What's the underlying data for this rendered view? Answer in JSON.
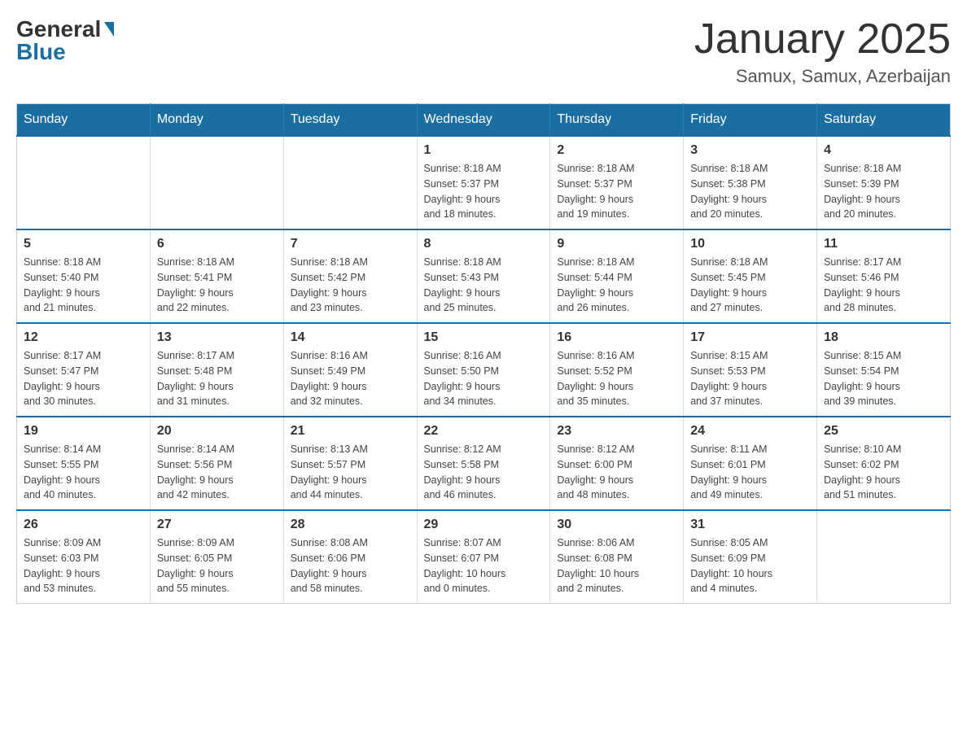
{
  "logo": {
    "general": "General",
    "blue": "Blue"
  },
  "title": "January 2025",
  "location": "Samux, Samux, Azerbaijan",
  "days_of_week": [
    "Sunday",
    "Monday",
    "Tuesday",
    "Wednesday",
    "Thursday",
    "Friday",
    "Saturday"
  ],
  "weeks": [
    [
      {
        "day": "",
        "info": ""
      },
      {
        "day": "",
        "info": ""
      },
      {
        "day": "",
        "info": ""
      },
      {
        "day": "1",
        "info": "Sunrise: 8:18 AM\nSunset: 5:37 PM\nDaylight: 9 hours\nand 18 minutes."
      },
      {
        "day": "2",
        "info": "Sunrise: 8:18 AM\nSunset: 5:37 PM\nDaylight: 9 hours\nand 19 minutes."
      },
      {
        "day": "3",
        "info": "Sunrise: 8:18 AM\nSunset: 5:38 PM\nDaylight: 9 hours\nand 20 minutes."
      },
      {
        "day": "4",
        "info": "Sunrise: 8:18 AM\nSunset: 5:39 PM\nDaylight: 9 hours\nand 20 minutes."
      }
    ],
    [
      {
        "day": "5",
        "info": "Sunrise: 8:18 AM\nSunset: 5:40 PM\nDaylight: 9 hours\nand 21 minutes."
      },
      {
        "day": "6",
        "info": "Sunrise: 8:18 AM\nSunset: 5:41 PM\nDaylight: 9 hours\nand 22 minutes."
      },
      {
        "day": "7",
        "info": "Sunrise: 8:18 AM\nSunset: 5:42 PM\nDaylight: 9 hours\nand 23 minutes."
      },
      {
        "day": "8",
        "info": "Sunrise: 8:18 AM\nSunset: 5:43 PM\nDaylight: 9 hours\nand 25 minutes."
      },
      {
        "day": "9",
        "info": "Sunrise: 8:18 AM\nSunset: 5:44 PM\nDaylight: 9 hours\nand 26 minutes."
      },
      {
        "day": "10",
        "info": "Sunrise: 8:18 AM\nSunset: 5:45 PM\nDaylight: 9 hours\nand 27 minutes."
      },
      {
        "day": "11",
        "info": "Sunrise: 8:17 AM\nSunset: 5:46 PM\nDaylight: 9 hours\nand 28 minutes."
      }
    ],
    [
      {
        "day": "12",
        "info": "Sunrise: 8:17 AM\nSunset: 5:47 PM\nDaylight: 9 hours\nand 30 minutes."
      },
      {
        "day": "13",
        "info": "Sunrise: 8:17 AM\nSunset: 5:48 PM\nDaylight: 9 hours\nand 31 minutes."
      },
      {
        "day": "14",
        "info": "Sunrise: 8:16 AM\nSunset: 5:49 PM\nDaylight: 9 hours\nand 32 minutes."
      },
      {
        "day": "15",
        "info": "Sunrise: 8:16 AM\nSunset: 5:50 PM\nDaylight: 9 hours\nand 34 minutes."
      },
      {
        "day": "16",
        "info": "Sunrise: 8:16 AM\nSunset: 5:52 PM\nDaylight: 9 hours\nand 35 minutes."
      },
      {
        "day": "17",
        "info": "Sunrise: 8:15 AM\nSunset: 5:53 PM\nDaylight: 9 hours\nand 37 minutes."
      },
      {
        "day": "18",
        "info": "Sunrise: 8:15 AM\nSunset: 5:54 PM\nDaylight: 9 hours\nand 39 minutes."
      }
    ],
    [
      {
        "day": "19",
        "info": "Sunrise: 8:14 AM\nSunset: 5:55 PM\nDaylight: 9 hours\nand 40 minutes."
      },
      {
        "day": "20",
        "info": "Sunrise: 8:14 AM\nSunset: 5:56 PM\nDaylight: 9 hours\nand 42 minutes."
      },
      {
        "day": "21",
        "info": "Sunrise: 8:13 AM\nSunset: 5:57 PM\nDaylight: 9 hours\nand 44 minutes."
      },
      {
        "day": "22",
        "info": "Sunrise: 8:12 AM\nSunset: 5:58 PM\nDaylight: 9 hours\nand 46 minutes."
      },
      {
        "day": "23",
        "info": "Sunrise: 8:12 AM\nSunset: 6:00 PM\nDaylight: 9 hours\nand 48 minutes."
      },
      {
        "day": "24",
        "info": "Sunrise: 8:11 AM\nSunset: 6:01 PM\nDaylight: 9 hours\nand 49 minutes."
      },
      {
        "day": "25",
        "info": "Sunrise: 8:10 AM\nSunset: 6:02 PM\nDaylight: 9 hours\nand 51 minutes."
      }
    ],
    [
      {
        "day": "26",
        "info": "Sunrise: 8:09 AM\nSunset: 6:03 PM\nDaylight: 9 hours\nand 53 minutes."
      },
      {
        "day": "27",
        "info": "Sunrise: 8:09 AM\nSunset: 6:05 PM\nDaylight: 9 hours\nand 55 minutes."
      },
      {
        "day": "28",
        "info": "Sunrise: 8:08 AM\nSunset: 6:06 PM\nDaylight: 9 hours\nand 58 minutes."
      },
      {
        "day": "29",
        "info": "Sunrise: 8:07 AM\nSunset: 6:07 PM\nDaylight: 10 hours\nand 0 minutes."
      },
      {
        "day": "30",
        "info": "Sunrise: 8:06 AM\nSunset: 6:08 PM\nDaylight: 10 hours\nand 2 minutes."
      },
      {
        "day": "31",
        "info": "Sunrise: 8:05 AM\nSunset: 6:09 PM\nDaylight: 10 hours\nand 4 minutes."
      },
      {
        "day": "",
        "info": ""
      }
    ]
  ]
}
